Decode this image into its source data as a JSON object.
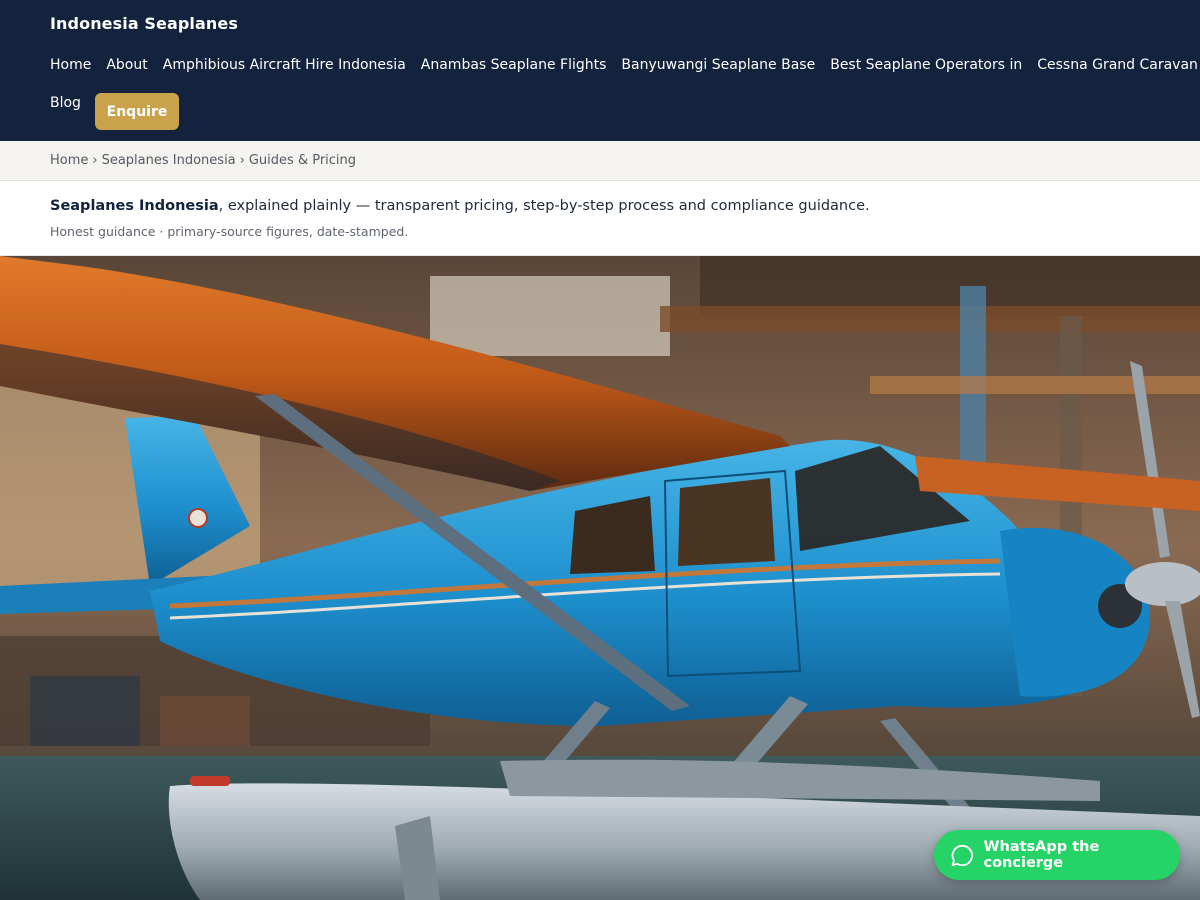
{
  "header": {
    "brand": "Indonesia Seaplanes",
    "nav": [
      {
        "label": "Home"
      },
      {
        "label": "About"
      },
      {
        "label": "Amphibious Aircraft Hire Indonesia"
      },
      {
        "label": "Anambas Seaplane Flights"
      },
      {
        "label": "Banyuwangi Seaplane Base"
      },
      {
        "label": "Best Seaplane Operators in"
      },
      {
        "label": "Cessna Grand Caravan EX"
      }
    ],
    "blog_label": "Blog",
    "enquire_label": "Enquire"
  },
  "breadcrumb": {
    "items": [
      "Home",
      "Seaplanes Indonesia",
      "Guides & Pricing"
    ],
    "separator": "›"
  },
  "intro": {
    "strong": "Seaplanes Indonesia",
    "rest": ", explained plainly — transparent pricing, step-by-step process and compliance guidance.",
    "sub": "Honest guidance · primary-source figures, date-stamped."
  },
  "hero": {
    "alt": "blue-seaplane-in-hangar"
  },
  "whatsapp": {
    "label": "WhatsApp the concierge"
  },
  "colors": {
    "header_bg": "#13233d",
    "accent": "#c9a24b",
    "whatsapp": "#25d366"
  }
}
